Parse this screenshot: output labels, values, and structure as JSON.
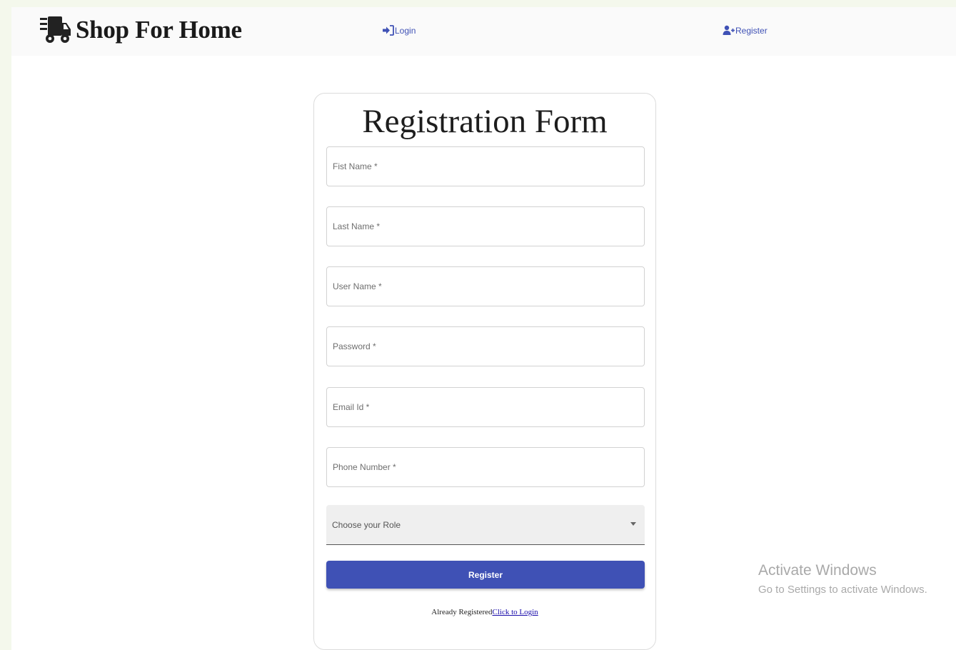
{
  "navbar": {
    "brand_title": "Shop For Home",
    "brand_icon": "delivery-truck-icon",
    "login_label": "Login",
    "login_icon": "sign-in-icon",
    "register_label": "Register",
    "register_icon": "user-plus-icon"
  },
  "form": {
    "title": "Registration Form",
    "fields": [
      {
        "placeholder": "Fist Name *"
      },
      {
        "placeholder": "Last Name *"
      },
      {
        "placeholder": "User Name *"
      },
      {
        "placeholder": "Password *"
      },
      {
        "placeholder": "Email Id *"
      },
      {
        "placeholder": "Phone Number *"
      }
    ],
    "role_select": {
      "label": "Choose your Role"
    },
    "submit_label": "Register",
    "already_registered": "Already Registered",
    "login_link": "Click to Login"
  },
  "watermark": {
    "title": "Activate Windows",
    "subtitle": "Go to Settings to activate Windows."
  },
  "colors": {
    "primary": "#3f51b5",
    "background": "#f4f8ec",
    "link": "#1a0dab"
  }
}
